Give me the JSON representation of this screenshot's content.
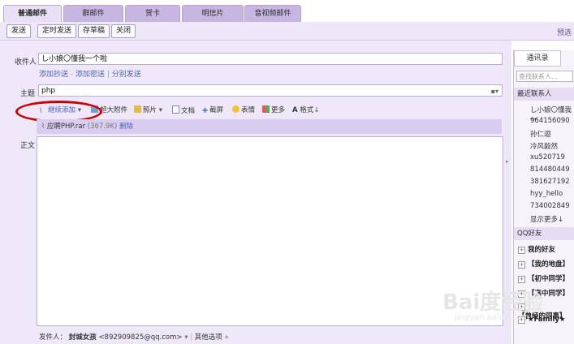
{
  "tabs": [
    "普通邮件",
    "群邮件",
    "贺卡",
    "明信片",
    "音视频邮件"
  ],
  "toolbar": {
    "send": "发送",
    "timed": "定时发送",
    "draft": "存草稿",
    "close": "关闭",
    "preview": "预选"
  },
  "form": {
    "to_label": "收件人",
    "to_value": "し小娘〇懂我一个啦",
    "add_cc": "添加抄送",
    "add_bcc": "添加密送",
    "separate": "分别发送",
    "subject_label": "主题",
    "subject_value": "php",
    "body_label": "正文"
  },
  "attach_tools": {
    "continue_add": "继续添加",
    "large": "超大附件",
    "photo": "照片",
    "doc": "文档",
    "screenshot": "截屏",
    "emoji": "表情",
    "more": "更多",
    "format": "格式"
  },
  "attachment": {
    "name": "应聘PHP.rar",
    "size": "(367.9K)",
    "delete": "删除"
  },
  "footer": {
    "sender_label": "发件人：",
    "sender_name": "封城女孩",
    "sender_email": "<892909825@qq.com>",
    "other": "其他选项"
  },
  "sidebar": {
    "tab": "通讯录",
    "search_placeholder": "查找联系人...",
    "recent_label": "最近联系人",
    "recent": [
      "し小娘〇懂我一",
      "964156090",
      "孙仁迴",
      "冷风毅然",
      "xu520719",
      "814480449",
      "381627192",
      "hyy_hello",
      "734002849"
    ],
    "show_more": "显示更多↓",
    "qq_label": "QQ好友",
    "groups": [
      "我的好友",
      "【我的地盘】",
      "【初中同学】",
      "【高中同学】",
      "【曾经的同事】",
      "★Family★"
    ]
  },
  "watermark": {
    "logo": "Bai度经验",
    "url": "jingyan.baidu.com"
  }
}
